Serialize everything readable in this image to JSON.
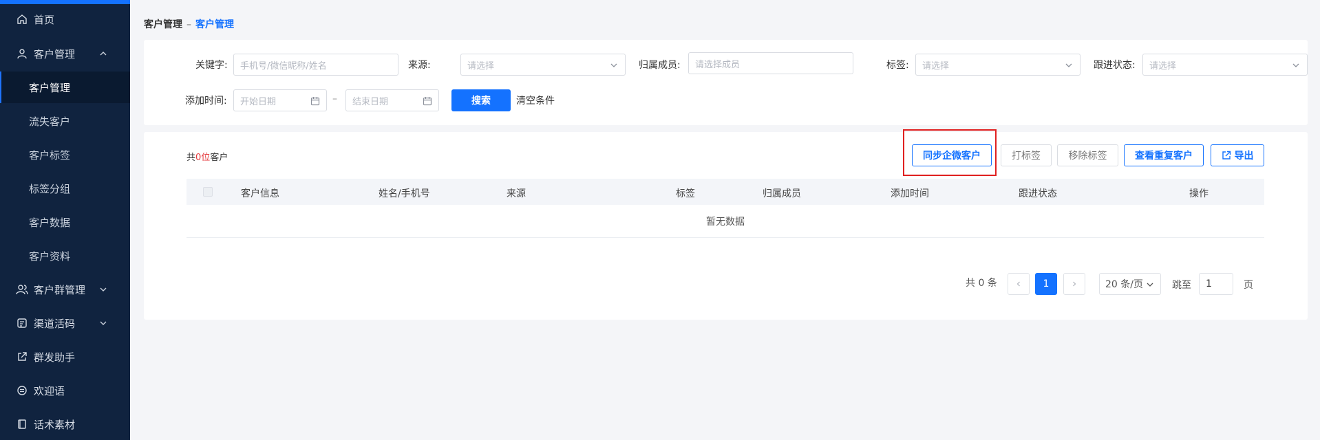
{
  "sidebar": {
    "items": [
      {
        "label": "首页",
        "icon": "home-icon"
      },
      {
        "label": "客户管理",
        "icon": "user-icon",
        "expanded": true,
        "children": [
          {
            "label": "客户管理",
            "active": true
          },
          {
            "label": "流失客户"
          },
          {
            "label": "客户标签"
          },
          {
            "label": "标签分组"
          },
          {
            "label": "客户数据"
          },
          {
            "label": "客户资料"
          }
        ]
      },
      {
        "label": "客户群管理",
        "icon": "users-icon"
      },
      {
        "label": "渠道活码",
        "icon": "qrcode-icon"
      },
      {
        "label": "群发助手",
        "icon": "external-link-icon"
      },
      {
        "label": "欢迎语",
        "icon": "message-icon"
      },
      {
        "label": "话术素材",
        "icon": "book-icon"
      }
    ]
  },
  "breadcrumb": {
    "parent": "客户管理",
    "separator": "–",
    "current": "客户管理"
  },
  "filters": {
    "keyword": {
      "label": "关键字:",
      "placeholder": "手机号/微信昵称/姓名"
    },
    "source": {
      "label": "来源:",
      "placeholder": "请选择"
    },
    "member": {
      "label": "归属成员:",
      "placeholder": "请选择成员"
    },
    "tag": {
      "label": "标签:",
      "placeholder": "请选择"
    },
    "follow_status": {
      "label": "跟进状态:",
      "placeholder": "请选择"
    },
    "add_time": {
      "label": "添加时间:",
      "start_placeholder": "开始日期",
      "range_sep": "–",
      "end_placeholder": "结束日期"
    },
    "search_label": "搜索",
    "clear_label": "清空条件"
  },
  "summary": {
    "prefix": "共",
    "count": "0",
    "unit": "位",
    "suffix": "客户"
  },
  "toolbar": {
    "sync_label": "同步企微客户",
    "tag_label": "打标签",
    "remove_tag_label": "移除标签",
    "dup_label": "查看重复客户",
    "export_label": "导出"
  },
  "table": {
    "columns": [
      "客户信息",
      "姓名/手机号",
      "来源",
      "标签",
      "归属成员",
      "添加时间",
      "跟进状态",
      "操作"
    ],
    "empty_text": "暂无数据"
  },
  "pagination": {
    "total_label": "共 0 条",
    "current_page": "1",
    "page_size_label": "20 条/页",
    "jump_label": "跳至",
    "jump_value": "1",
    "page_unit": "页"
  },
  "colors": {
    "accent": "#1472ff",
    "sidebar_bg": "#10233f",
    "highlight": "#e02020",
    "count": "#e4393c"
  }
}
